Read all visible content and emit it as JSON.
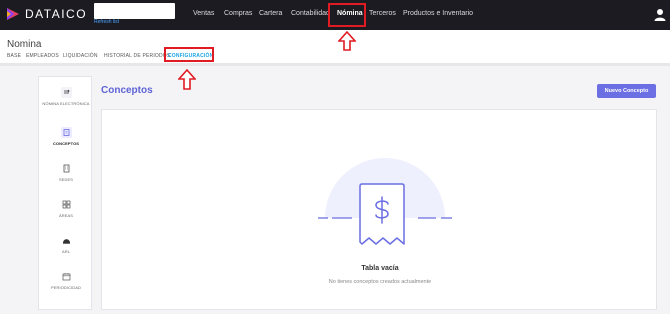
{
  "topbar": {
    "brand": "DATAICO",
    "refresh_link": "Refresh list",
    "nav": [
      {
        "label": "Ventas"
      },
      {
        "label": "Compras"
      },
      {
        "label": "Cartera"
      },
      {
        "label": "Contabilidad"
      },
      {
        "label": "Nómina",
        "active": true
      },
      {
        "label": "Terceros"
      },
      {
        "label": "Productos e Inventario"
      }
    ]
  },
  "page": {
    "title": "Nomina",
    "subnav": [
      {
        "label": "BASE"
      },
      {
        "label": "EMPLEADOS"
      },
      {
        "label": "LIQUIDACIÓN"
      },
      {
        "label": "HISTORIAL DE PERIODOS"
      },
      {
        "label": "CONFIGURACIÓN",
        "active": true
      }
    ]
  },
  "sidebar": {
    "items": [
      {
        "label": "NÓMINA ELECTRÓNICA",
        "icon": "receipt-icon"
      },
      {
        "label": "CONCEPTOS",
        "icon": "document-icon",
        "active": true
      },
      {
        "label": "SEDES",
        "icon": "building-icon"
      },
      {
        "label": "ÁREAS",
        "icon": "grid-icon"
      },
      {
        "label": "ARL",
        "icon": "helmet-icon"
      },
      {
        "label": "PERIODICIDAD",
        "icon": "calendar-icon"
      }
    ]
  },
  "main": {
    "title": "Conceptos",
    "new_button": "Nuevo Concepto",
    "empty_title": "Tabla vacía",
    "empty_subtitle": "No tienes conceptos creados actualmente"
  },
  "colors": {
    "topbar": "#1b1b21",
    "accent": "#6b6fe3",
    "highlight": "#e01b24",
    "active_link": "#1aa3e8"
  }
}
